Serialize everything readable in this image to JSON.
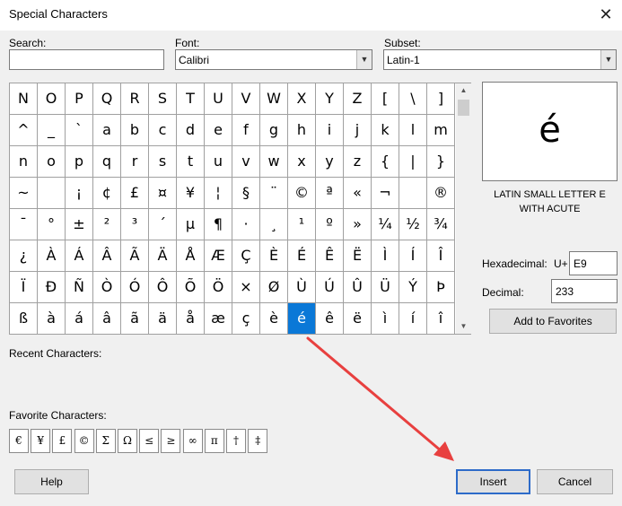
{
  "window": {
    "title": "Special Characters",
    "close_glyph": "✕"
  },
  "search": {
    "label": "Search:",
    "value": ""
  },
  "font": {
    "label": "Font:",
    "value": "Calibri"
  },
  "subset": {
    "label": "Subset:",
    "value": "Latin-1"
  },
  "grid": {
    "selected": "é",
    "rows": [
      [
        "N",
        "O",
        "P",
        "Q",
        "R",
        "S",
        "T",
        "U",
        "V",
        "W",
        "X",
        "Y",
        "Z",
        "[",
        "\\",
        "]"
      ],
      [
        "^",
        "_",
        "`",
        "a",
        "b",
        "c",
        "d",
        "e",
        "f",
        "g",
        "h",
        "i",
        "j",
        "k",
        "l",
        "m"
      ],
      [
        "n",
        "o",
        "p",
        "q",
        "r",
        "s",
        "t",
        "u",
        "v",
        "w",
        "x",
        "y",
        "z",
        "{",
        "|",
        "}"
      ],
      [
        "~",
        "",
        "¡",
        "¢",
        "£",
        "¤",
        "¥",
        "¦",
        "§",
        "¨",
        "©",
        "ª",
        "«",
        "¬",
        "",
        "®"
      ],
      [
        "¯",
        "°",
        "±",
        "²",
        "³",
        "´",
        "µ",
        "¶",
        "·",
        "¸",
        "¹",
        "º",
        "»",
        "¼",
        "½",
        "¾"
      ],
      [
        "¿",
        "À",
        "Á",
        "Â",
        "Ã",
        "Ä",
        "Å",
        "Æ",
        "Ç",
        "È",
        "É",
        "Ê",
        "Ë",
        "Ì",
        "Í",
        "Î"
      ],
      [
        "Ï",
        "Ð",
        "Ñ",
        "Ò",
        "Ó",
        "Ô",
        "Õ",
        "Ö",
        "×",
        "Ø",
        "Ù",
        "Ú",
        "Û",
        "Ü",
        "Ý",
        "Þ"
      ],
      [
        "ß",
        "à",
        "á",
        "â",
        "ã",
        "ä",
        "å",
        "æ",
        "ç",
        "è",
        "é",
        "ê",
        "ë",
        "ì",
        "í",
        "î"
      ]
    ]
  },
  "preview": {
    "glyph": "é",
    "name": "LATIN SMALL LETTER E WITH ACUTE"
  },
  "hexadecimal": {
    "label": "Hexadecimal:",
    "prefix": "U+",
    "value": "E9"
  },
  "decimal": {
    "label": "Decimal:",
    "value": "233"
  },
  "buttons": {
    "add_favorites": "Add to Favorites",
    "help": "Help",
    "insert": "Insert",
    "cancel": "Cancel"
  },
  "recent": {
    "label": "Recent Characters:"
  },
  "favorites": {
    "label": "Favorite Characters:",
    "items": [
      "€",
      "¥",
      "£",
      "©",
      "Σ",
      "Ω",
      "≤",
      "≥",
      "∞",
      "π",
      "†",
      "‡"
    ]
  },
  "colors": {
    "selection": "#0a78d7",
    "annotation_arrow": "#e8403f",
    "default_button_border": "#2d6bc9"
  }
}
